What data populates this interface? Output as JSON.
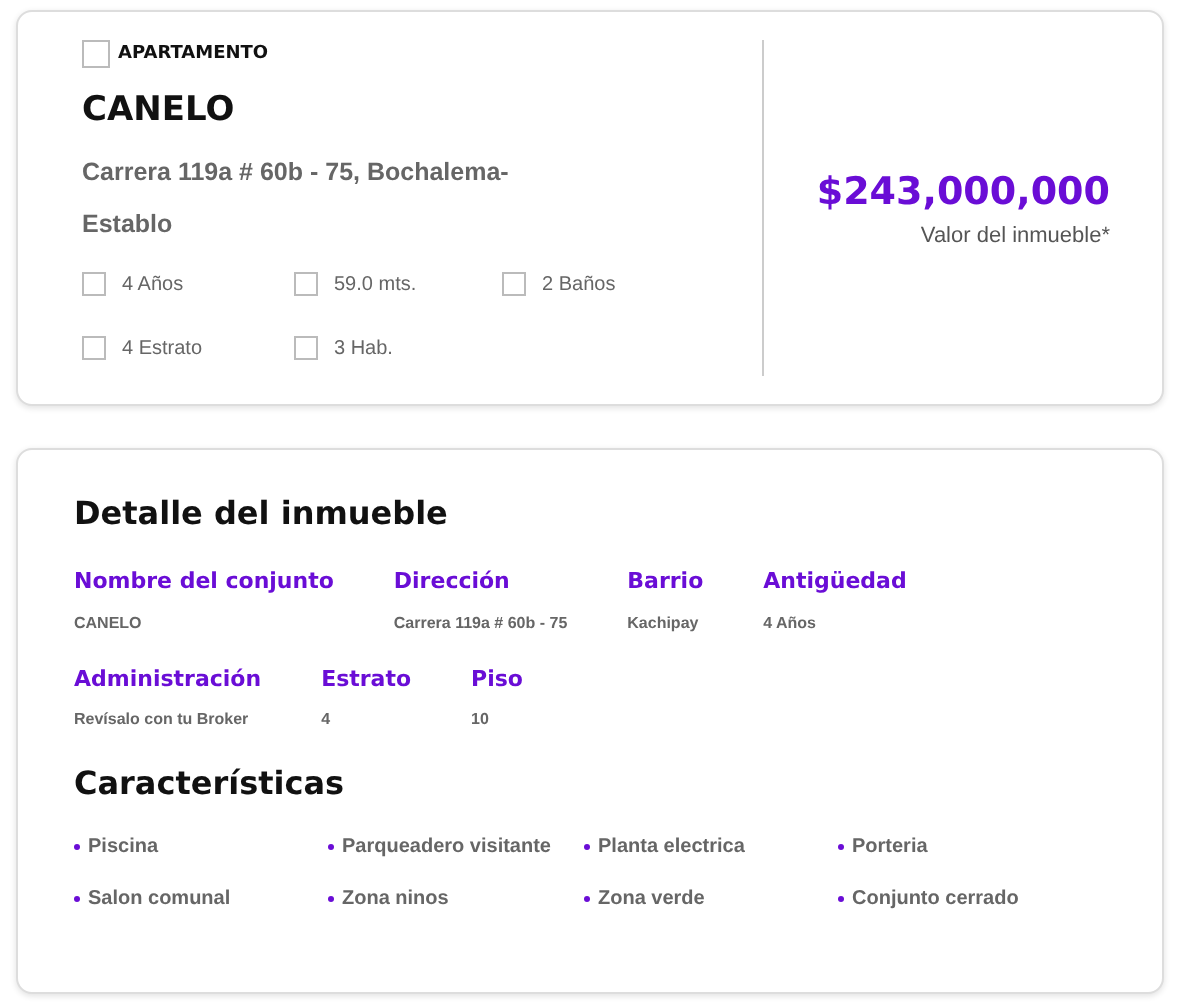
{
  "property": {
    "type_checked": false,
    "type": "APARTAMENTO",
    "name": "CANELO",
    "address": "Carrera 119a # 60b - 75, Bochalema-Establo",
    "facts": [
      {
        "label": "4 Años",
        "checked": false
      },
      {
        "label": "59.0 mts.",
        "checked": false
      },
      {
        "label": "2 Baños",
        "checked": false
      },
      {
        "label": "4 Estrato",
        "checked": false
      },
      {
        "label": "3 Hab.",
        "checked": false
      }
    ],
    "price": "$243,000,000",
    "price_label": "Valor del inmueble*"
  },
  "detail": {
    "title": "Detalle del inmueble",
    "groups": [
      {
        "fields": [
          {
            "label": "Nombre del conjunto",
            "value": "CANELO"
          },
          {
            "label": "Dirección",
            "value": "Carrera 119a # 60b - 75"
          },
          {
            "label": "Barrio",
            "value": "Kachipay"
          },
          {
            "label": "Antigüedad",
            "value": "4 Años"
          }
        ]
      },
      {
        "fields": [
          {
            "label": "Administración",
            "value": "Revísalo con tu Broker"
          },
          {
            "label": "Estrato",
            "value": "4"
          },
          {
            "label": "Piso",
            "value": "10"
          }
        ]
      }
    ]
  },
  "features": {
    "title": "Características",
    "items": [
      "Piscina",
      "Parqueadero visitante",
      "Planta electrica",
      "Porteria",
      "Salon comunal",
      "Zona ninos",
      "Zona verde",
      "Conjunto cerrado"
    ]
  }
}
